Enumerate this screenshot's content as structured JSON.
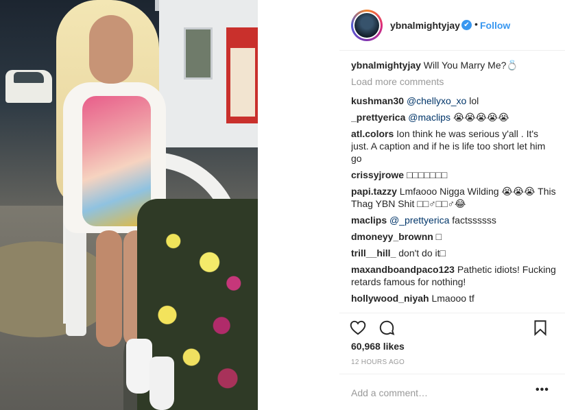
{
  "post": {
    "photo_alt": "woman in graphic sweater dress at gas station"
  },
  "header": {
    "username": "ybnalmightyjay",
    "verified_glyph": "✔",
    "separator": "•",
    "follow_label": "Follow"
  },
  "caption": {
    "username": "ybnalmightyjay",
    "text": " Will You Marry Me?💍"
  },
  "load_more_label": "Load more comments",
  "comments": [
    {
      "username": "kushman30",
      "mention": "@chellyxo_xo",
      "text": " lol"
    },
    {
      "username": "_prettyerica",
      "mention": "@maclips",
      "text": " 😭😭😭😭😭"
    },
    {
      "username": "atl.colors",
      "mention": "",
      "text": " Ion think he was serious y'all . It's just. A caption and if he is life too short let him go"
    },
    {
      "username": "crissyjrowe",
      "mention": "",
      "text": " □□□□□□□"
    },
    {
      "username": "papi.tazzy",
      "mention": "",
      "text": " Lmfaooo Nigga Wilding 😭😭😭 This Thag YBN Shit □□♂□□♂😂"
    },
    {
      "username": "maclips",
      "mention": "@_prettyerica",
      "text": " factssssss"
    },
    {
      "username": "dmoneyy_brownn",
      "mention": "",
      "text": " □"
    },
    {
      "username": "trill__hill_",
      "mention": "",
      "text": " don't do it□"
    },
    {
      "username": "maxandboandpaco123",
      "mention": "",
      "text": " Pathetic idiots! Fucking retards famous for nothing!"
    },
    {
      "username": "hollywood_niyah",
      "mention": "",
      "text": " Lmaooo tf"
    }
  ],
  "icons": {
    "like": "heart-icon",
    "comment": "comment-bubble-icon",
    "save": "bookmark-icon",
    "more": "more-options-icon"
  },
  "likes_text": "60,968 likes",
  "time_text": "12 HOURS AGO",
  "add_comment": {
    "placeholder": "Add a comment…",
    "more_glyph": "•••"
  },
  "colors": {
    "link_blue": "#3897f0",
    "mention_blue": "#003569",
    "muted_gray": "#999999",
    "text": "#262626"
  }
}
